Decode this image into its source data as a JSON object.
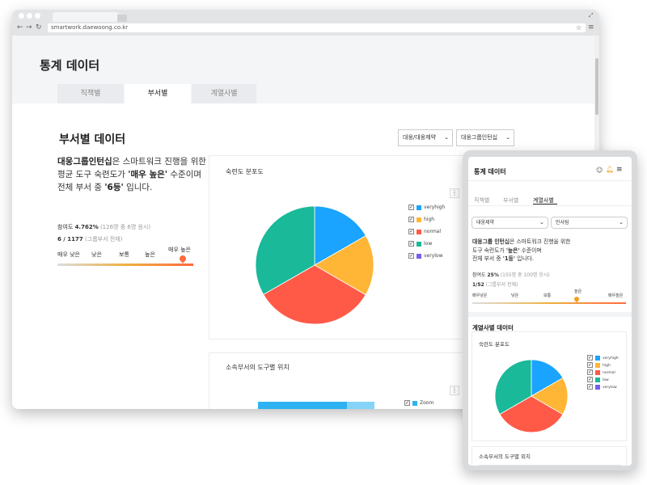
{
  "browser": {
    "url": "smartwork.daewoong.co.kr"
  },
  "desktop": {
    "page_title": "통계 데이터",
    "tabs": [
      "직책별",
      "부서별",
      "계열사별"
    ],
    "active_tab": 1,
    "section_title": "부서별 데이터",
    "filters": [
      "대웅/대웅제약",
      "대웅그룹인턴십"
    ],
    "summary": {
      "name": "대웅그룹인턴십",
      "line1": "은 스마트워크 진행을 위한",
      "line2_pre": "평균 도구 숙련도가 ",
      "level": "'매우 높은'",
      "line2_post": " 수준이며",
      "line3_pre": "전체 부서 중 ",
      "rank": "'6등'",
      "line3_post": " 입니다."
    },
    "participation_label": "참여도",
    "participation_value": "4.762%",
    "participation_detail": "(126명 중 6명 응시)",
    "rank_value": "6 / 1177",
    "rank_detail": "(그룹부서 전체)",
    "scale_labels": [
      "매우 낮은",
      "낮은",
      "보통",
      "높은",
      "매우 높은"
    ],
    "scale_marker": 0.92,
    "chart1_title": "숙련도 분포도",
    "chart2_title": "소속부서의 도구별 위치",
    "chart2_legend": "Zoom"
  },
  "legend": [
    {
      "name": "veryhigh",
      "color": "#1aa3ff"
    },
    {
      "name": "high",
      "color": "#ffb636"
    },
    {
      "name": "normal",
      "color": "#ff5a48"
    },
    {
      "name": "low",
      "color": "#19b99a"
    },
    {
      "name": "verylow",
      "color": "#7a5cf0"
    }
  ],
  "mobile": {
    "title": "통계 데이터",
    "tabs": [
      "직책별",
      "부서별",
      "계열사별"
    ],
    "active_tab": 2,
    "filters": [
      "대웅제약",
      "인사팀"
    ],
    "summary": {
      "name": "대웅그룹 인턴십",
      "line1": "은 스마트워크 진행을 위한",
      "line2_pre": "도구 숙련도가 ",
      "level": "'높은'",
      "line2_post": " 수준이며",
      "line3_pre": "전체 부서 중 ",
      "rank": "'1등'",
      "line3_post": " 입니다."
    },
    "participation_label": "참여도",
    "participation_value": "25%",
    "participation_detail": "(155명 중 100명 응시)",
    "rank_value": "1/52",
    "rank_detail": "(그룹부서 전체)",
    "scale_labels": [
      "매우낮은",
      "낮은",
      "보통",
      "높은",
      "매우높은"
    ],
    "scale_marker": 0.68,
    "section_title": "계열사별 데이터",
    "chart1_title": "숙련도 분포도",
    "chart2_title": "소속부서의 도구별 위치"
  },
  "chart_data": {
    "type": "pie",
    "title": "숙련도 분포도",
    "categories": [
      "veryhigh",
      "high",
      "normal",
      "low",
      "verylow"
    ],
    "values": [
      16.7,
      16.7,
      33.3,
      33.3,
      0
    ]
  }
}
